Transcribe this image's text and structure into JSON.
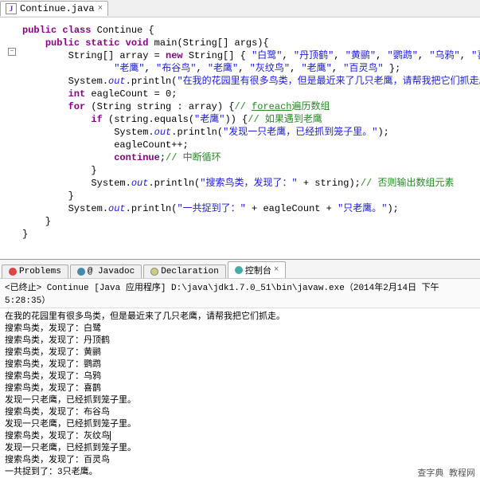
{
  "editor": {
    "fileName": "Continue.java",
    "code_tokens": [
      [
        {
          "t": "",
          "c": ""
        }
      ],
      [
        {
          "t": "public",
          "c": "kw"
        },
        {
          "t": " ",
          "c": ""
        },
        {
          "t": "class",
          "c": "kw"
        },
        {
          "t": " Continue {",
          "c": "cls"
        }
      ],
      [
        {
          "t": "    ",
          "c": ""
        },
        {
          "t": "public",
          "c": "kw"
        },
        {
          "t": " ",
          "c": ""
        },
        {
          "t": "static",
          "c": "kw"
        },
        {
          "t": " ",
          "c": ""
        },
        {
          "t": "void",
          "c": "kw"
        },
        {
          "t": " main(String[] args){",
          "c": "cls"
        }
      ],
      [
        {
          "t": "        String[] array = ",
          "c": "cls"
        },
        {
          "t": "new",
          "c": "kw"
        },
        {
          "t": " String[] { ",
          "c": "cls"
        },
        {
          "t": "\"白鹭\"",
          "c": "str"
        },
        {
          "t": ", ",
          "c": ""
        },
        {
          "t": "\"丹顶鹤\"",
          "c": "str"
        },
        {
          "t": ", ",
          "c": ""
        },
        {
          "t": "\"黄鹂\"",
          "c": "str"
        },
        {
          "t": ", ",
          "c": ""
        },
        {
          "t": "\"鹦鹉\"",
          "c": "str"
        },
        {
          "t": ", ",
          "c": ""
        },
        {
          "t": "\"乌鸦\"",
          "c": "str"
        },
        {
          "t": ", ",
          "c": ""
        },
        {
          "t": "\"喜鹊\"",
          "c": "str"
        },
        {
          "t": ",",
          "c": ""
        }
      ],
      [
        {
          "t": "                ",
          "c": ""
        },
        {
          "t": "\"老鹰\"",
          "c": "str"
        },
        {
          "t": ", ",
          "c": ""
        },
        {
          "t": "\"布谷鸟\"",
          "c": "str"
        },
        {
          "t": ", ",
          "c": ""
        },
        {
          "t": "\"老鹰\"",
          "c": "str"
        },
        {
          "t": ", ",
          "c": ""
        },
        {
          "t": "\"灰纹鸟\"",
          "c": "str"
        },
        {
          "t": ", ",
          "c": ""
        },
        {
          "t": "\"老鹰\"",
          "c": "str"
        },
        {
          "t": ", ",
          "c": ""
        },
        {
          "t": "\"百灵鸟\"",
          "c": "str"
        },
        {
          "t": " };",
          "c": ""
        }
      ],
      [
        {
          "t": "        System.",
          "c": ""
        },
        {
          "t": "out",
          "c": "fld"
        },
        {
          "t": ".println(",
          "c": ""
        },
        {
          "t": "\"在我的花园里有很多鸟类，但是最近来了几只老鹰，请帮我把它们抓走。\"",
          "c": "str"
        },
        {
          "t": ");",
          "c": ""
        }
      ],
      [
        {
          "t": "        ",
          "c": ""
        },
        {
          "t": "int",
          "c": "kw"
        },
        {
          "t": " eagleCount = 0;",
          "c": ""
        }
      ],
      [
        {
          "t": "        ",
          "c": ""
        },
        {
          "t": "for",
          "c": "kw"
        },
        {
          "t": " (String string : array) {",
          "c": ""
        },
        {
          "t": "// ",
          "c": "cmt"
        },
        {
          "t": "foreach",
          "c": "cmt",
          "u": 1
        },
        {
          "t": "遍历数组",
          "c": "cmt"
        }
      ],
      [
        {
          "t": "            ",
          "c": ""
        },
        {
          "t": "if",
          "c": "kw"
        },
        {
          "t": " (string.equals(",
          "c": ""
        },
        {
          "t": "\"老鹰\"",
          "c": "str"
        },
        {
          "t": ")) {",
          "c": ""
        },
        {
          "t": "// 如果遇到老鹰",
          "c": "cmt"
        }
      ],
      [
        {
          "t": "                System.",
          "c": ""
        },
        {
          "t": "out",
          "c": "fld"
        },
        {
          "t": ".println(",
          "c": ""
        },
        {
          "t": "\"发现一只老鹰，已经抓到笼子里。\"",
          "c": "str"
        },
        {
          "t": ");",
          "c": ""
        }
      ],
      [
        {
          "t": "                eagleCount++;",
          "c": ""
        }
      ],
      [
        {
          "t": "                ",
          "c": ""
        },
        {
          "t": "continue",
          "c": "kw"
        },
        {
          "t": ";",
          "c": ""
        },
        {
          "t": "// 中断循环",
          "c": "cmt"
        }
      ],
      [
        {
          "t": "            }",
          "c": ""
        }
      ],
      [
        {
          "t": "            System.",
          "c": ""
        },
        {
          "t": "out",
          "c": "fld"
        },
        {
          "t": ".println(",
          "c": ""
        },
        {
          "t": "\"搜索鸟类，发现了：\"",
          "c": "str"
        },
        {
          "t": " + string);",
          "c": ""
        },
        {
          "t": "// 否则输出数组元素",
          "c": "cmt"
        }
      ],
      [
        {
          "t": "        }",
          "c": ""
        }
      ],
      [
        {
          "t": "        System.",
          "c": ""
        },
        {
          "t": "out",
          "c": "fld"
        },
        {
          "t": ".println(",
          "c": ""
        },
        {
          "t": "\"一共捉到了：\"",
          "c": "str"
        },
        {
          "t": " + eagleCount + ",
          "c": ""
        },
        {
          "t": "\"只老鹰。\"",
          "c": "str"
        },
        {
          "t": ");",
          "c": ""
        }
      ],
      [
        {
          "t": "    }",
          "c": ""
        }
      ],
      [
        {
          "t": "}",
          "c": ""
        }
      ]
    ]
  },
  "tabs": {
    "problems": "Problems",
    "javadoc": "@ Javadoc",
    "declaration": "Declaration",
    "console": "控制台"
  },
  "terminatedLine": "<已终止> Continue [Java 应用程序] D:\\java\\jdk1.7.0_51\\bin\\javaw.exe（2014年2月14日 下午5:28:35）",
  "consoleLines": [
    "在我的花园里有很多鸟类，但是最近来了几只老鹰，请帮我把它们抓走。",
    "搜索鸟类，发现了：白鹭",
    "搜索鸟类，发现了：丹顶鹤",
    "搜索鸟类，发现了：黄鹂",
    "搜索鸟类，发现了：鹦鹉",
    "搜索鸟类，发现了：乌鸦",
    "搜索鸟类，发现了：喜鹊",
    "发现一只老鹰，已经抓到笼子里。",
    "搜索鸟类，发现了：布谷鸟",
    "发现一只老鹰，已经抓到笼子里。",
    "搜索鸟类，发现了：灰纹鸟",
    "发现一只老鹰，已经抓到笼子里。",
    "搜索鸟类，发现了：百灵鸟",
    "一共捉到了：3只老鹰。"
  ],
  "watermark": "查字典 教程网"
}
